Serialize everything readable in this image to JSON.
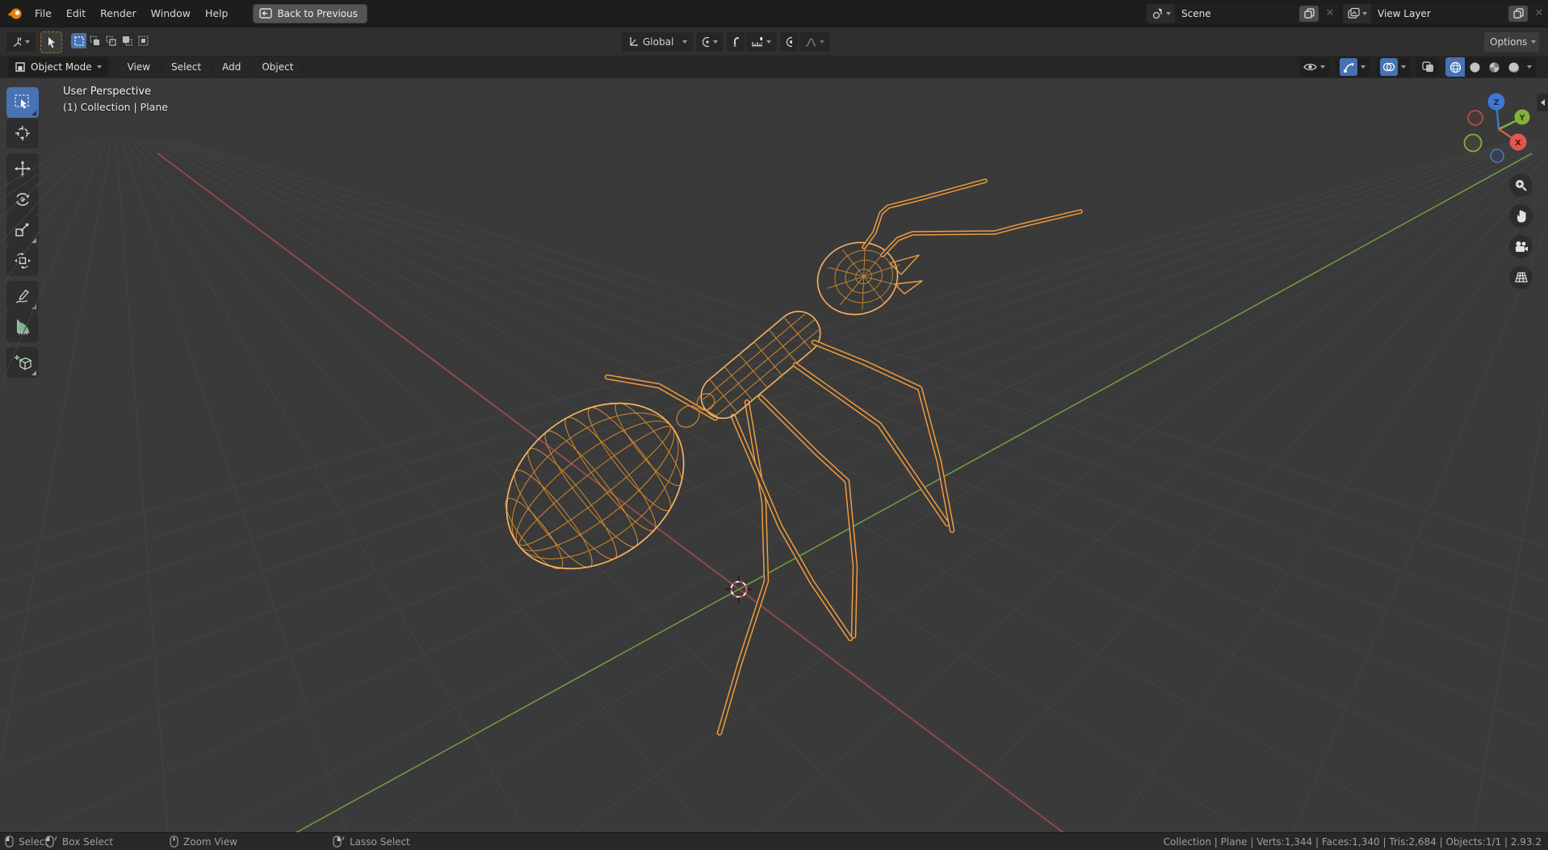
{
  "topbar": {
    "menus": [
      "File",
      "Edit",
      "Render",
      "Window",
      "Help"
    ],
    "back_button": "Back to Previous",
    "scene": {
      "value": "Scene"
    },
    "view_layer": {
      "value": "View Layer"
    }
  },
  "tool_settings": {
    "orientation": "Global",
    "options_label": "Options"
  },
  "viewport_header": {
    "mode": "Object Mode",
    "menus": [
      "View",
      "Select",
      "Add",
      "Object"
    ]
  },
  "viewport": {
    "perspective_label": "User Perspective",
    "breadcrumb": "(1) Collection | Plane"
  },
  "left_toolbar": {
    "tools": [
      "select-box",
      "cursor",
      "move",
      "rotate",
      "scale",
      "transform",
      "annotate",
      "measure",
      "add-cube"
    ]
  },
  "gizmo": {
    "x": "X",
    "y": "Y",
    "z": "Z"
  },
  "status_bar": {
    "hints": [
      {
        "mouse": "lmb",
        "label": "Select"
      },
      {
        "mouse": "lmb-drag",
        "label": "Box Select"
      },
      {
        "mouse": "mmb",
        "label": "Zoom View"
      },
      {
        "mouse": "rmb-drag",
        "label": "Lasso Select"
      }
    ],
    "info": "Collection | Plane | Verts:1,344 | Faces:1,340 | Tris:2,684 | Objects:1/1 | 2.93.2"
  },
  "colors": {
    "accent_blue": "#4772b3",
    "selection_orange": "#ef9b3f",
    "axis_x": "#a04b4b",
    "axis_y": "#6d9b41",
    "axis_z": "#3f77d4"
  }
}
